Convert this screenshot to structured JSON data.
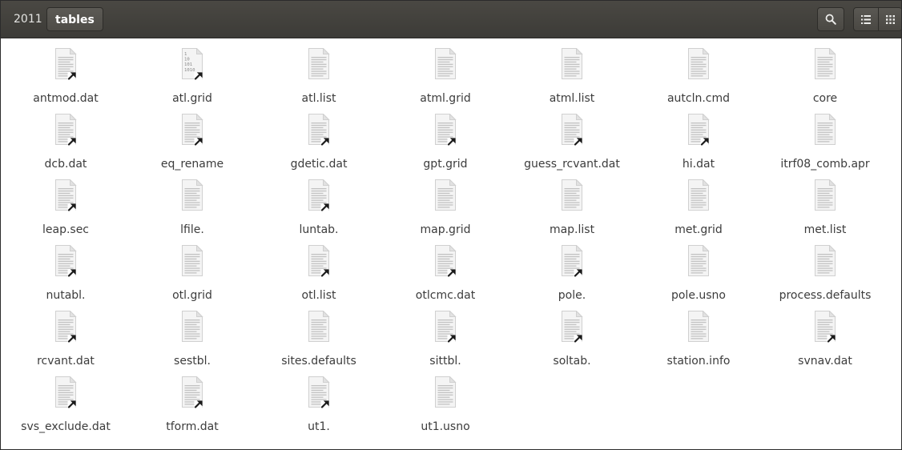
{
  "breadcrumb": {
    "parent": "2011",
    "current": "tables"
  },
  "toolbar": {
    "search_icon": "search-icon",
    "list_view_icon": "list-view-icon",
    "grid_view_icon": "grid-view-icon"
  },
  "files": [
    {
      "name": "antmod.dat",
      "icon": "text-link"
    },
    {
      "name": "atl.grid",
      "icon": "binary-link"
    },
    {
      "name": "atl.list",
      "icon": "text"
    },
    {
      "name": "atml.grid",
      "icon": "text"
    },
    {
      "name": "atml.list",
      "icon": "text"
    },
    {
      "name": "autcln.cmd",
      "icon": "text"
    },
    {
      "name": "core",
      "icon": "text"
    },
    {
      "name": "dcb.dat",
      "icon": "text-link"
    },
    {
      "name": "eq_rename",
      "icon": "text-link"
    },
    {
      "name": "gdetic.dat",
      "icon": "text-link"
    },
    {
      "name": "gpt.grid",
      "icon": "text-link"
    },
    {
      "name": "guess_rcvant.dat",
      "icon": "text-link"
    },
    {
      "name": "hi.dat",
      "icon": "text-link"
    },
    {
      "name": "itrf08_comb.apr",
      "icon": "text"
    },
    {
      "name": "leap.sec",
      "icon": "text-link"
    },
    {
      "name": "lfile.",
      "icon": "text"
    },
    {
      "name": "luntab.",
      "icon": "text-link"
    },
    {
      "name": "map.grid",
      "icon": "text"
    },
    {
      "name": "map.list",
      "icon": "text"
    },
    {
      "name": "met.grid",
      "icon": "text"
    },
    {
      "name": "met.list",
      "icon": "text"
    },
    {
      "name": "nutabl.",
      "icon": "text-link"
    },
    {
      "name": "otl.grid",
      "icon": "text"
    },
    {
      "name": "otl.list",
      "icon": "text-link"
    },
    {
      "name": "otlcmc.dat",
      "icon": "text-link"
    },
    {
      "name": "pole.",
      "icon": "text-link"
    },
    {
      "name": "pole.usno",
      "icon": "text"
    },
    {
      "name": "process.defaults",
      "icon": "text"
    },
    {
      "name": "rcvant.dat",
      "icon": "text-link"
    },
    {
      "name": "sestbl.",
      "icon": "text"
    },
    {
      "name": "sites.defaults",
      "icon": "text"
    },
    {
      "name": "sittbl.",
      "icon": "text-link"
    },
    {
      "name": "soltab.",
      "icon": "text-link"
    },
    {
      "name": "station.info",
      "icon": "text"
    },
    {
      "name": "svnav.dat",
      "icon": "text-link"
    },
    {
      "name": "svs_exclude.dat",
      "icon": "text-link"
    },
    {
      "name": "tform.dat",
      "icon": "text-link"
    },
    {
      "name": "ut1.",
      "icon": "text-link"
    },
    {
      "name": "ut1.usno",
      "icon": "text"
    }
  ],
  "binary_icon_lines": [
    "1",
    "10",
    "101",
    "1010"
  ],
  "colors": {
    "toolbar": "#3c3b37",
    "link_arrow": "#1a1a1a",
    "page": "#f4f4f4",
    "text_lines": "#c2c2c2"
  }
}
